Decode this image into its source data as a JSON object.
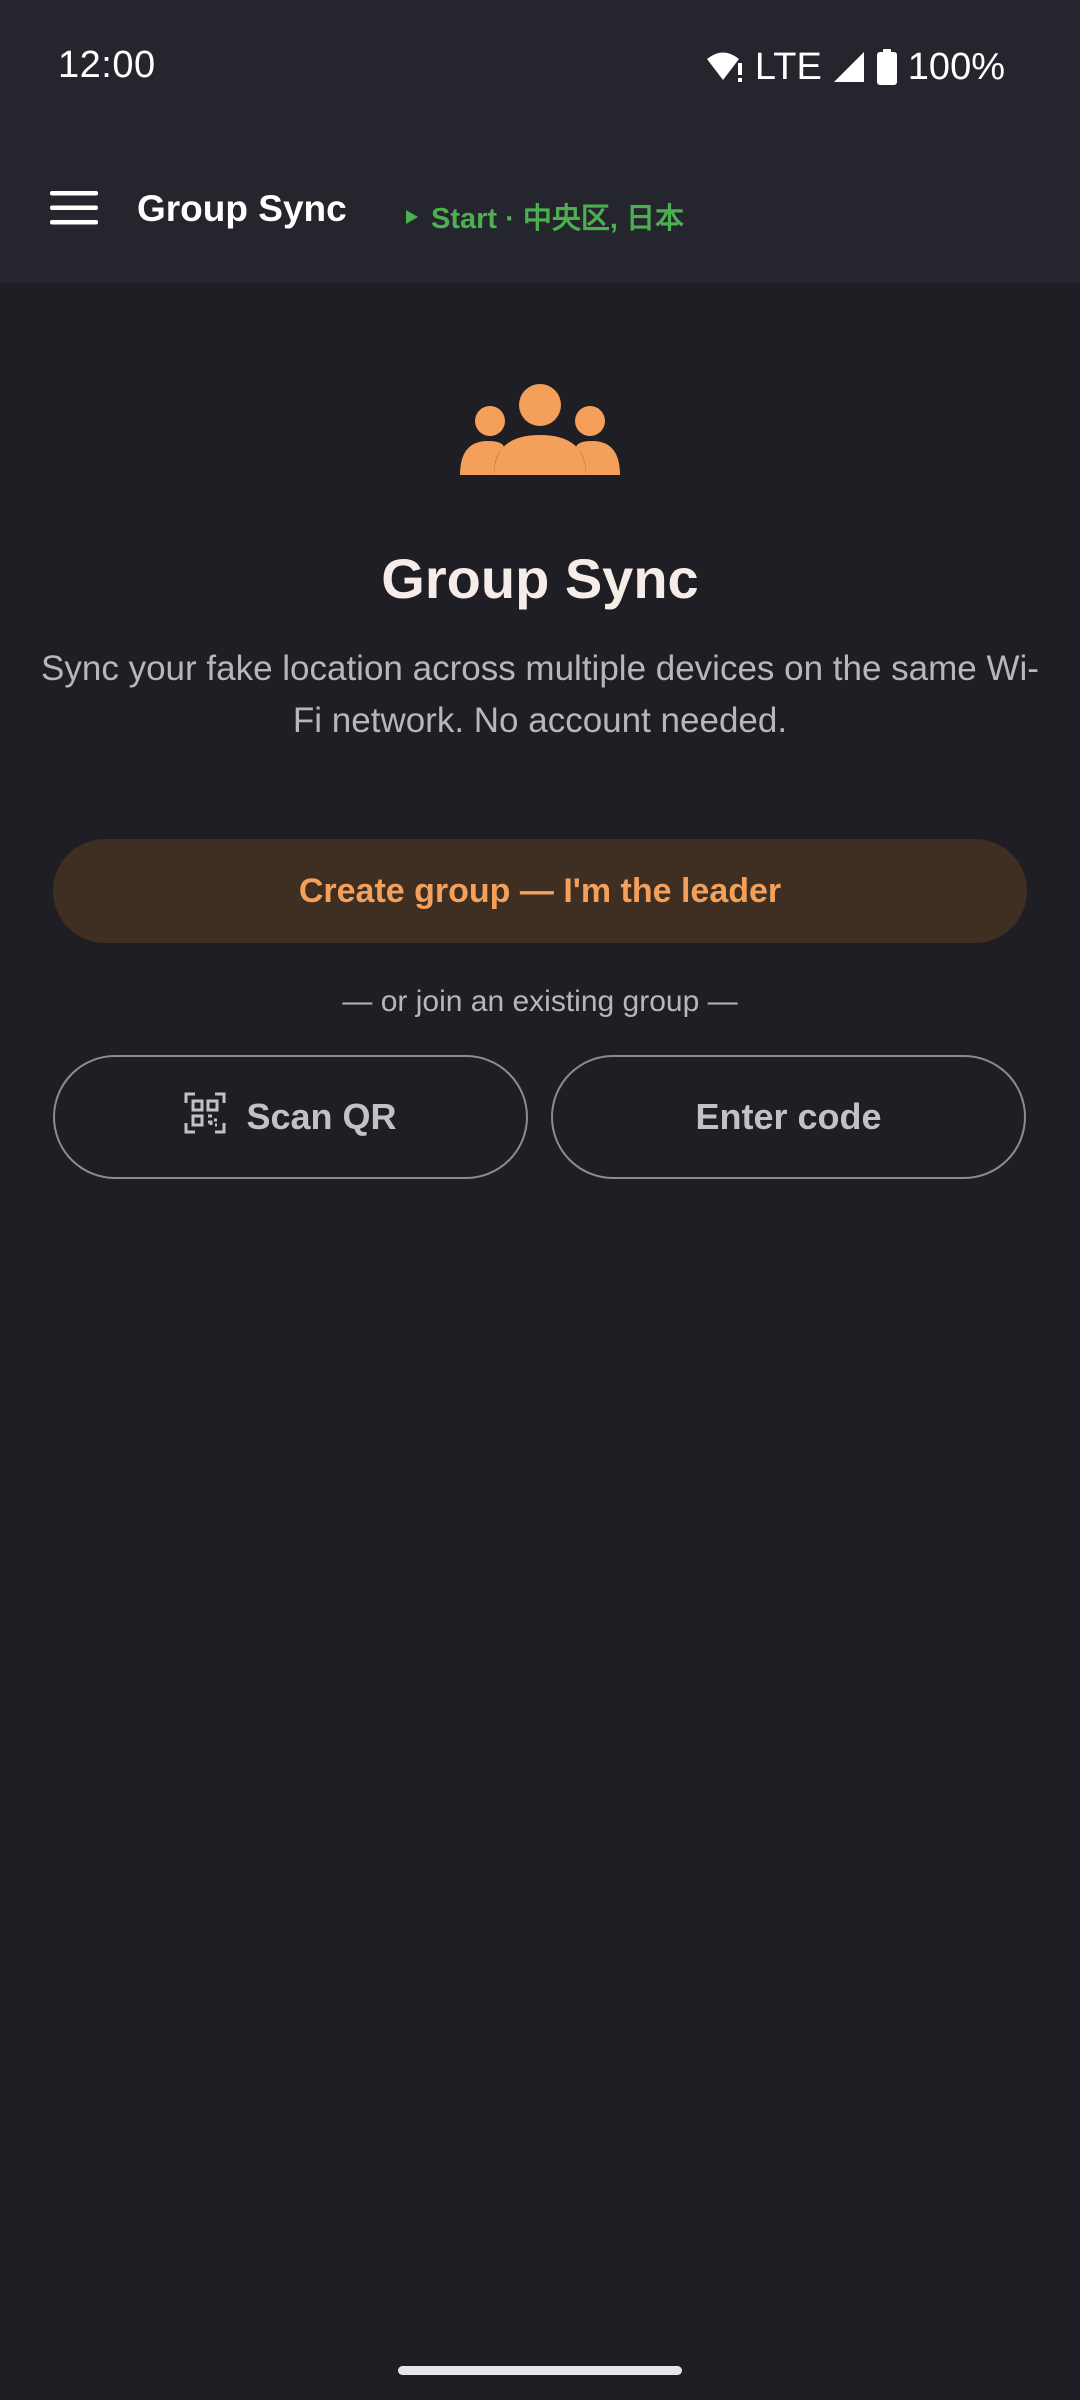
{
  "status_bar": {
    "time": "12:00",
    "network": "LTE",
    "battery": "100%",
    "icons": [
      "wifi-alert-icon",
      "cell-signal-icon",
      "battery-icon"
    ]
  },
  "app_bar": {
    "title": "Group Sync",
    "location_prefix": "Start",
    "location_separator": " · ",
    "location": "中央区, 日本",
    "menu_icon": "hamburger-menu-icon",
    "location_icon": "play-triangle-icon"
  },
  "hero": {
    "icon": "group-people-icon",
    "title": "Group Sync",
    "description": "Sync your fake location across multiple devices on the same Wi-Fi network. No account needed."
  },
  "actions": {
    "create_label": "Create group — I'm the leader",
    "or_label": "— or join an existing group —",
    "scan_label": "Scan QR",
    "scan_icon": "qr-scan-icon",
    "code_label": "Enter code"
  },
  "colors": {
    "accent": "#f4a05b",
    "accent_container": "#3f2f22",
    "location_green": "#4caf50",
    "background": "#1f1e24",
    "surface": "#25252d"
  }
}
